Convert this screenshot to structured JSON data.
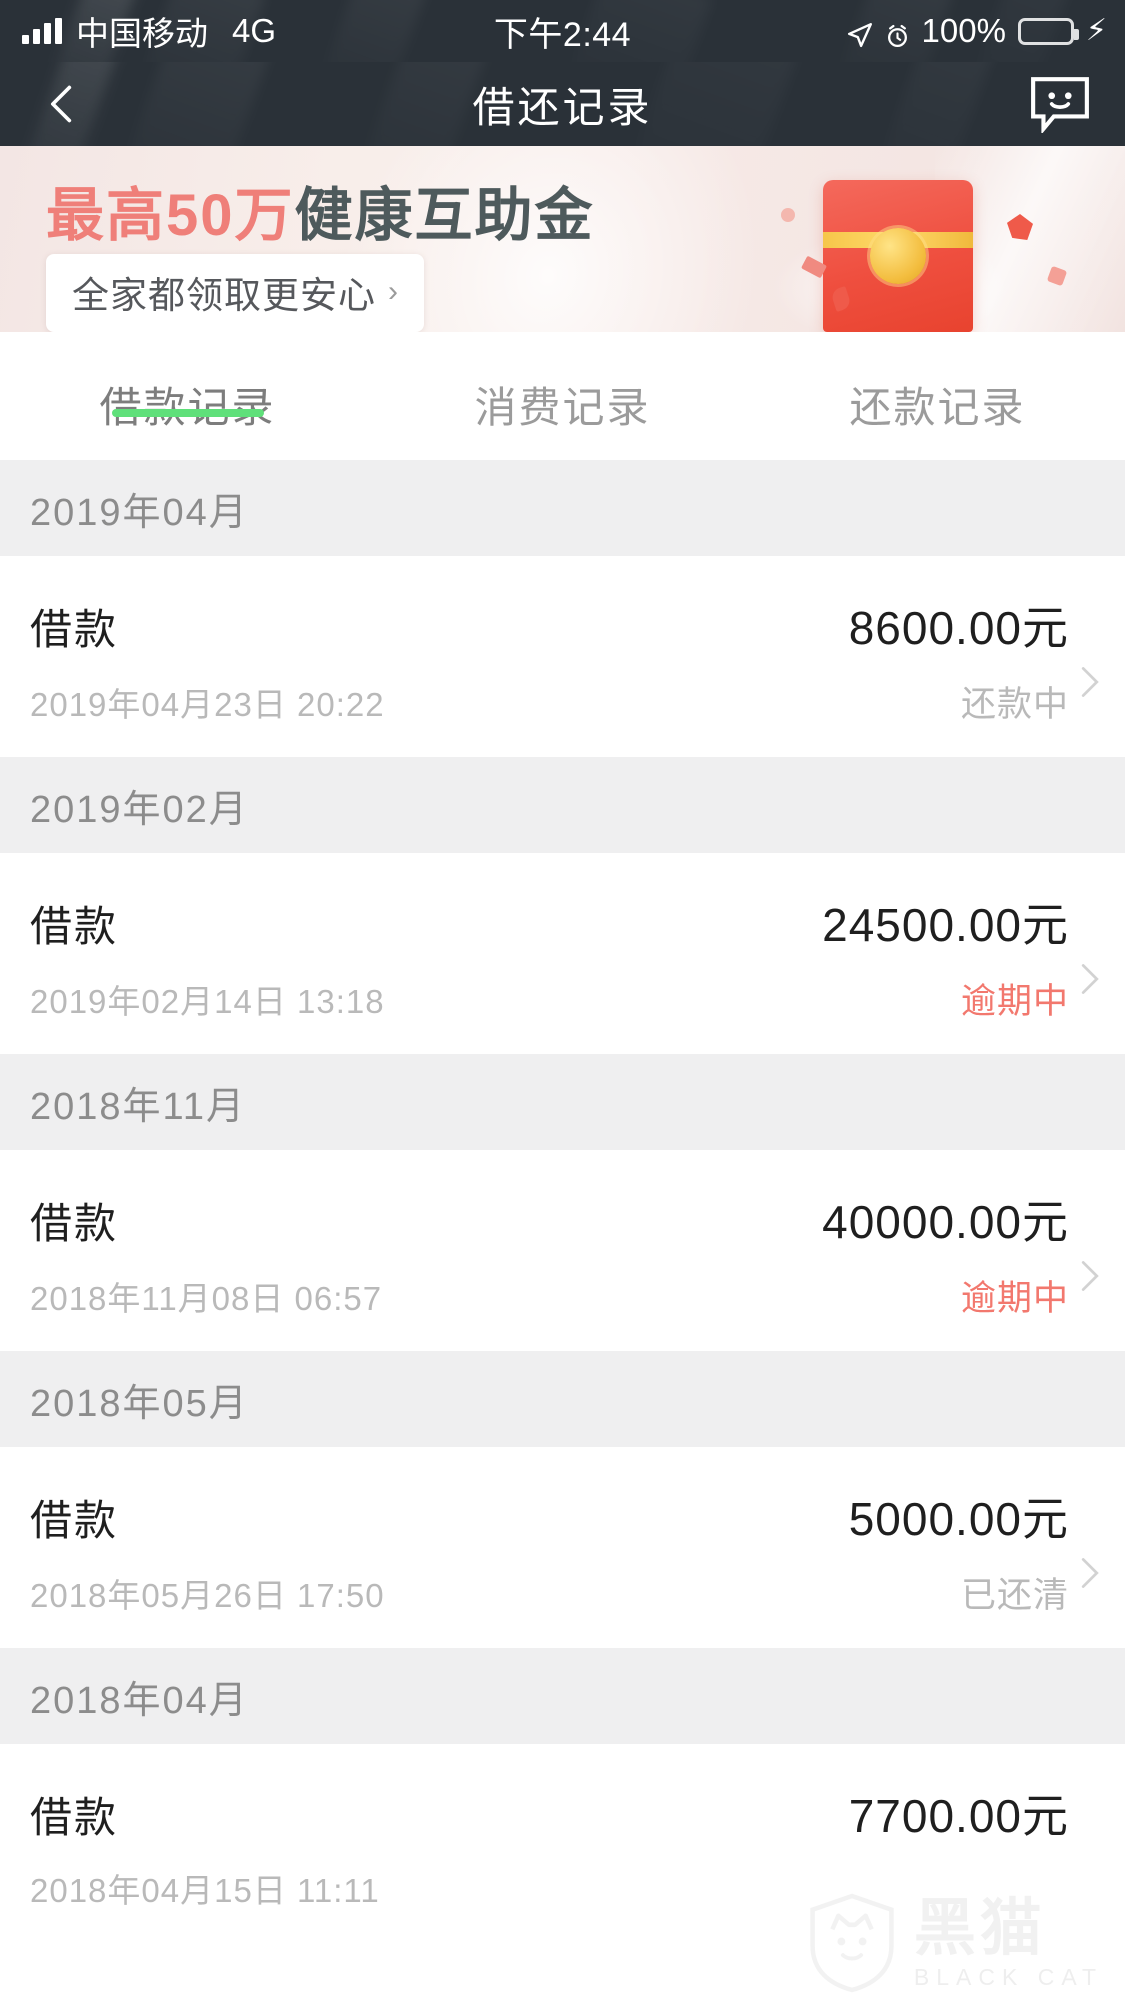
{
  "statusbar": {
    "carrier": "中国移动",
    "network": "4G",
    "time": "下午2:44",
    "battery": "100%",
    "signal_icon": "signal-bars-icon",
    "location_icon": "location-arrow-icon",
    "alarm_icon": "alarm-clock-icon",
    "battery_icon": "battery-icon",
    "charging_icon": "lightning-bolt-icon"
  },
  "navbar": {
    "title": "借还记录",
    "back_icon": "chevron-left-icon",
    "chat_icon": "chat-smiley-icon"
  },
  "banner": {
    "highlight": "最高50万",
    "rest": "健康互助金",
    "cta": "全家都领取更安心",
    "cta_chevron": "›",
    "highlight_color": "#ef7f79",
    "rest_color": "#4e5a5c",
    "art": "red-envelope-icon"
  },
  "tabs": [
    {
      "label": "借款记录",
      "active": true
    },
    {
      "label": "消费记录",
      "active": false
    },
    {
      "label": "还款记录",
      "active": false
    }
  ],
  "accent_color": "#5fe07a",
  "overdue_color": "#f2786e",
  "groups": [
    {
      "month": "2019年04月",
      "records": [
        {
          "title": "借款",
          "amount": "8600.00元",
          "date": "2019年04月23日 20:22",
          "status": "还款中",
          "overdue": false
        }
      ]
    },
    {
      "month": "2019年02月",
      "records": [
        {
          "title": "借款",
          "amount": "24500.00元",
          "date": "2019年02月14日 13:18",
          "status": "逾期中",
          "overdue": true
        }
      ]
    },
    {
      "month": "2018年11月",
      "records": [
        {
          "title": "借款",
          "amount": "40000.00元",
          "date": "2018年11月08日 06:57",
          "status": "逾期中",
          "overdue": true
        }
      ]
    },
    {
      "month": "2018年05月",
      "records": [
        {
          "title": "借款",
          "amount": "5000.00元",
          "date": "2018年05月26日 17:50",
          "status": "已还清",
          "overdue": false
        }
      ]
    },
    {
      "month": "2018年04月",
      "records": [
        {
          "title": "借款",
          "amount": "7700.00元",
          "date": "2018年04月15日 11:11",
          "status": "",
          "overdue": false
        }
      ]
    }
  ],
  "watermark": {
    "main": "黑猫",
    "sub": "BLACK CAT",
    "icon": "cat-shield-icon"
  }
}
